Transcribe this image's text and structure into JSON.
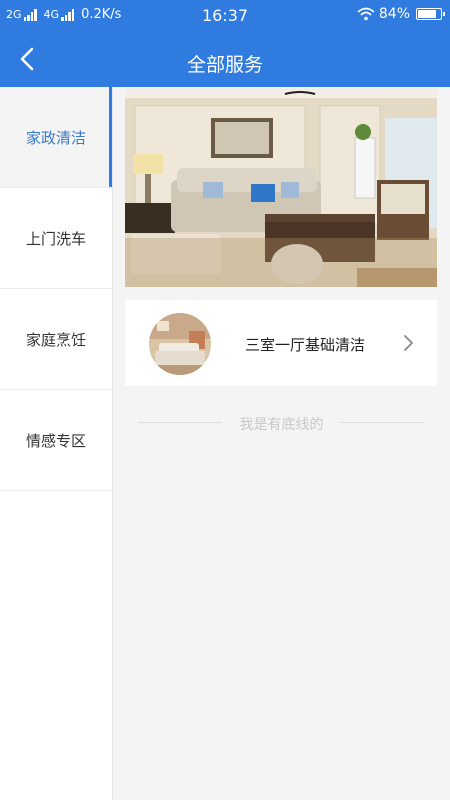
{
  "status_bar": {
    "net1": "2G",
    "net2": "4G",
    "speed": "0.2K/s",
    "time": "16:37",
    "battery": "84%",
    "battery_level": 0.84
  },
  "header": {
    "title": "全部服务"
  },
  "sidebar": {
    "items": [
      {
        "label": "家政清洁",
        "active": true
      },
      {
        "label": "上门洗车"
      },
      {
        "label": "家庭烹饪"
      },
      {
        "label": "情感专区"
      }
    ]
  },
  "service": {
    "title": "三室一厅基础清洁"
  },
  "footer": {
    "end_text": "我是有底线的"
  },
  "colors": {
    "primary": "#2f7be0",
    "active_text": "#3a78c9"
  }
}
